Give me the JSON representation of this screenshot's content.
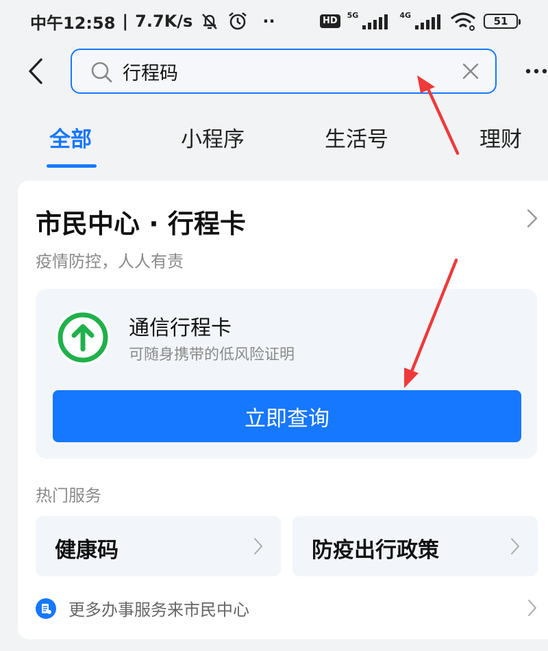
{
  "status_bar": {
    "time": "中午12:58",
    "separator": "|",
    "net_speed": "7.7K/s",
    "dots": "··",
    "hd": "HD",
    "net_5g": "5G",
    "net_4g": "4G",
    "battery": "51"
  },
  "search": {
    "query": "行程码"
  },
  "tabs": [
    {
      "label": "全部",
      "active": true
    },
    {
      "label": "小程序",
      "active": false
    },
    {
      "label": "生活号",
      "active": false
    },
    {
      "label": "理财",
      "active": false
    }
  ],
  "card": {
    "title": "市民中心 · 行程卡",
    "subtitle": "疫情防控，人人有责",
    "app": {
      "name": "通信行程卡",
      "description": "可随身携带的低风险证明",
      "icon": "green-up-arrow-icon"
    },
    "query_button": "立即查询",
    "section_title": "热门服务",
    "services": [
      {
        "label": "健康码"
      },
      {
        "label": "防疫出行政策"
      }
    ],
    "more_services": "更多办事服务来市民中心"
  },
  "colors": {
    "accent": "#1677ff",
    "annotation_arrow": "#ee3a3a",
    "app_icon_green": "#21b04b"
  }
}
